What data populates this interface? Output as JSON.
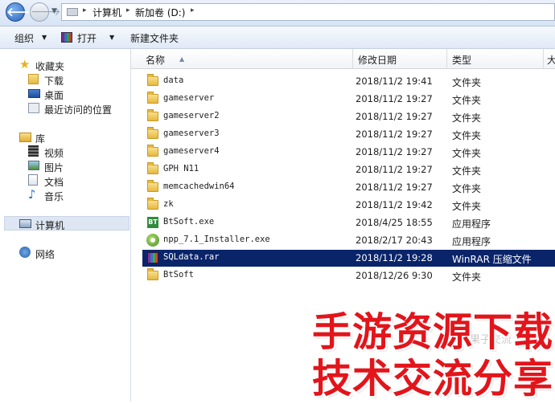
{
  "address_bar": {
    "breadcrumbs": [
      "计算机",
      "新加卷 (D:)"
    ]
  },
  "toolbar": {
    "organize_label": "组织",
    "open_label": "打开",
    "new_folder_label": "新建文件夹"
  },
  "nav": {
    "favorites": {
      "label": "收藏夹",
      "items": [
        "下载",
        "桌面",
        "最近访问的位置"
      ]
    },
    "libraries": {
      "label": "库",
      "items": [
        "视频",
        "图片",
        "文档",
        "音乐"
      ]
    },
    "computer_label": "计算机",
    "network_label": "网络"
  },
  "columns": {
    "name": "名称",
    "date": "修改日期",
    "type": "类型",
    "size": "大"
  },
  "files": [
    {
      "name": "data",
      "date": "2018/11/2 19:41",
      "type": "文件夹",
      "kind": "folder"
    },
    {
      "name": "gameserver",
      "date": "2018/11/2 19:27",
      "type": "文件夹",
      "kind": "folder"
    },
    {
      "name": "gameserver2",
      "date": "2018/11/2 19:27",
      "type": "文件夹",
      "kind": "folder"
    },
    {
      "name": "gameserver3",
      "date": "2018/11/2 19:27",
      "type": "文件夹",
      "kind": "folder"
    },
    {
      "name": "gameserver4",
      "date": "2018/11/2 19:27",
      "type": "文件夹",
      "kind": "folder"
    },
    {
      "name": "GPH N11",
      "date": "2018/11/2 19:27",
      "type": "文件夹",
      "kind": "folder"
    },
    {
      "name": "memcachedwin64",
      "date": "2018/11/2 19:27",
      "type": "文件夹",
      "kind": "folder"
    },
    {
      "name": "zk",
      "date": "2018/11/2 19:42",
      "type": "文件夹",
      "kind": "folder"
    },
    {
      "name": "BtSoft.exe",
      "date": "2018/4/25 18:55",
      "type": "应用程序",
      "kind": "bt-exe"
    },
    {
      "name": "npp_7.1_Installer.exe",
      "date": "2018/2/17 20:43",
      "type": "应用程序",
      "kind": "npp-exe"
    },
    {
      "name": "SQLdata.rar",
      "date": "2018/11/2 19:28",
      "type": "WinRAR 压缩文件",
      "kind": "rar",
      "selected": true
    },
    {
      "name": "BtSoft",
      "date": "2018/12/26 9:30",
      "type": "文件夹",
      "kind": "folder"
    }
  ],
  "watermark": {
    "line1": "手游资源下载",
    "line2": "技术交流分享",
    "ghost_text": "果子交流"
  },
  "icons": {
    "back": "back-arrow-icon",
    "forward": "forward-arrow-icon",
    "bt_label": "BT"
  },
  "colors": {
    "selection": "#0a246a",
    "watermark_red": "#e2151b"
  }
}
